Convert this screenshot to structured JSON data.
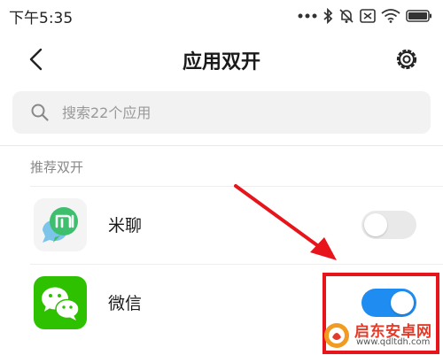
{
  "status_bar": {
    "time": "下午5:35",
    "icons": [
      "signal-dots-icon",
      "bluetooth-icon",
      "mute-icon",
      "notification-icon",
      "wifi-icon",
      "battery-icon"
    ]
  },
  "header": {
    "title": "应用双开",
    "back_icon": "chevron-left-icon",
    "settings_icon": "gear-icon"
  },
  "search": {
    "placeholder": "搜索22个应用",
    "value": ""
  },
  "section": {
    "title": "推荐双开"
  },
  "apps": [
    {
      "name": "米聊",
      "icon": "miliao-app-icon",
      "enabled": false
    },
    {
      "name": "微信",
      "icon": "wechat-app-icon",
      "enabled": true
    }
  ],
  "watermark": {
    "text": "启东安卓网",
    "url": "www.qdltdh.com"
  },
  "colors": {
    "toggle_on": "#1e8cf0",
    "toggle_off": "#e9e9e9",
    "annotation_red": "#e8141c",
    "wechat_green": "#2dc100"
  }
}
